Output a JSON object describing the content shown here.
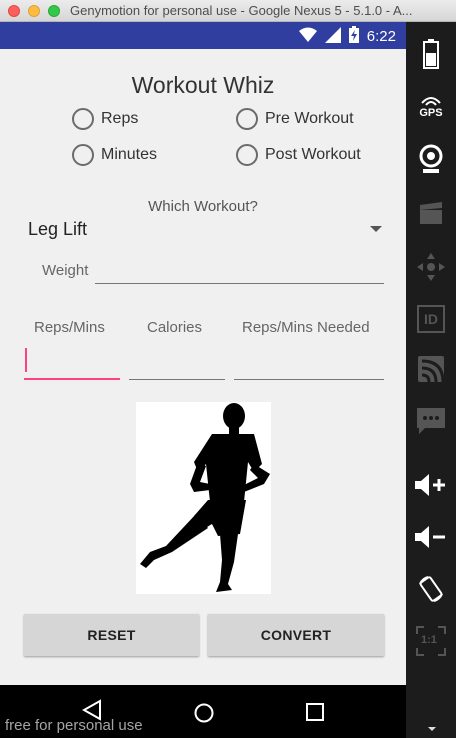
{
  "window": {
    "title": "Genymotion for personal use - Google Nexus 5 - 5.1.0 - A..."
  },
  "status_bar": {
    "time": "6:22"
  },
  "app": {
    "title": "Workout Whiz",
    "radios": [
      {
        "label": "Reps",
        "checked": false
      },
      {
        "label": "Pre Workout",
        "checked": false
      },
      {
        "label": "Minutes",
        "checked": false
      },
      {
        "label": "Post Workout",
        "checked": false
      }
    ],
    "which_label": "Which Workout?",
    "workout_selected": "Leg Lift",
    "weight_label": "Weight",
    "weight_value": "",
    "columns": {
      "reps_mins": "Reps/Mins",
      "calories": "Calories",
      "reps_needed": "Reps/Mins Needed"
    },
    "fields": {
      "reps_mins": "",
      "calories": "",
      "reps_needed": ""
    },
    "buttons": {
      "reset": "RESET",
      "convert": "CONVERT"
    }
  },
  "watermark": "free for personal use",
  "sidebar": {
    "gps_label": "GPS",
    "id_label": "ID",
    "pixel_label": "1:1"
  },
  "colors": {
    "status_bar": "#303f9f",
    "accent": "#ff4081",
    "app_bg": "#f0f0f0"
  }
}
